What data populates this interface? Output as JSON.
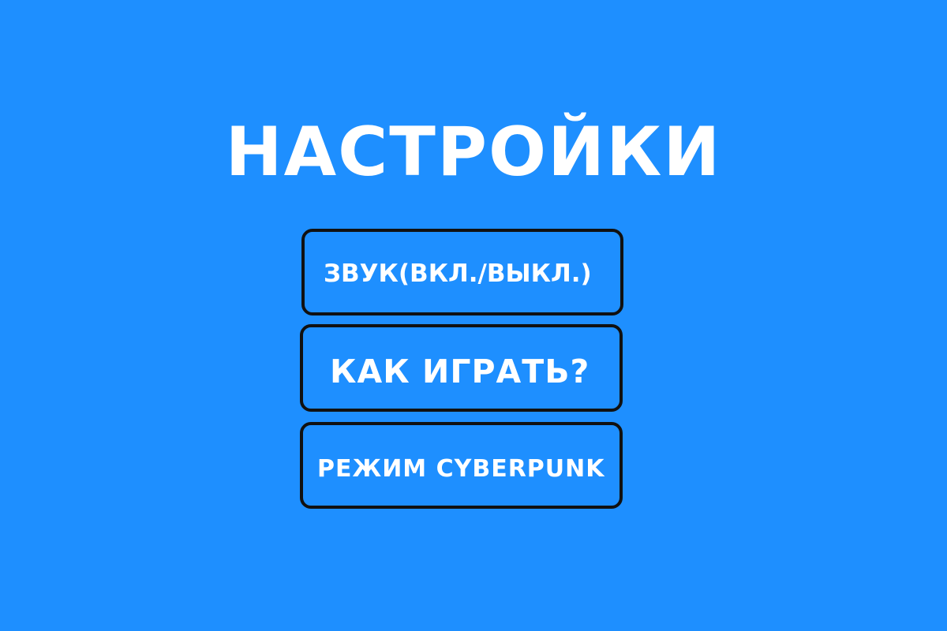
{
  "colors": {
    "background": "#1e8fff",
    "text": "#ffffff",
    "button_border": "#111111"
  },
  "settings_menu": {
    "title": "НАСТРОЙКИ",
    "buttons": [
      {
        "label": "ЗВУК(ВКЛ./ВЫКЛ.)"
      },
      {
        "label": "КАК ИГРАТЬ?"
      },
      {
        "label": "РЕЖИМ CYBERPUNK"
      }
    ]
  }
}
